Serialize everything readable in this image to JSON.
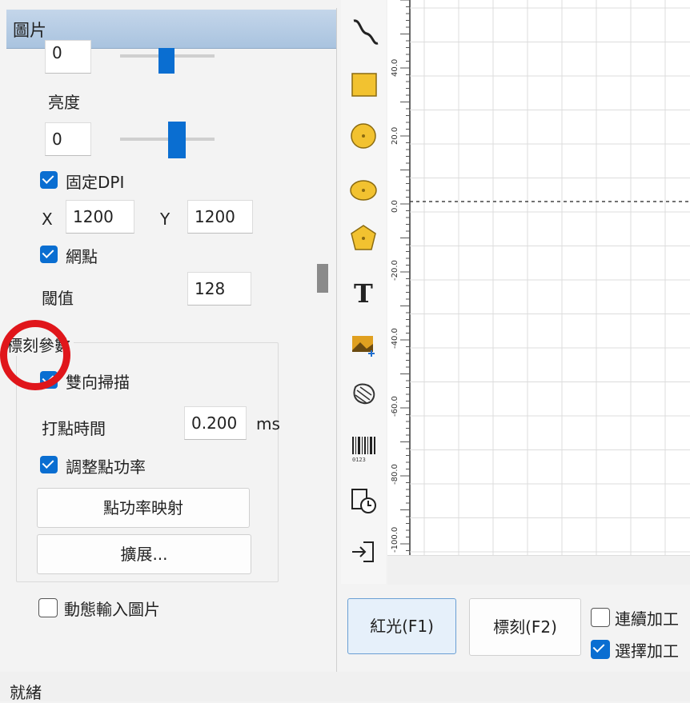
{
  "panel": {
    "title": "圖片",
    "top_field_value": "0",
    "brightness_label": "亮度",
    "brightness_value": "0",
    "fixed_dpi_label": "固定DPI",
    "x_label": "X",
    "x_value": "1200",
    "y_label": "Y",
    "y_value": "1200",
    "halftone_label": "網點",
    "threshold_label": "閾值",
    "threshold_value": "128",
    "marking_group_title": "標刻參數",
    "bidirectional_label": "雙向掃描",
    "dot_time_label": "打點時間",
    "dot_time_value": "0.200",
    "dot_time_unit": "ms",
    "adjust_power_label": "調整點功率",
    "power_map_button": "點功率映射",
    "extend_button": "擴展...",
    "dynamic_input_label": "動態輸入圖片"
  },
  "ruler": {
    "labels": [
      "40.0",
      "20.0",
      "0.0",
      "-20.0",
      "-40.0",
      "-60.0",
      "-80.0",
      "-100.0"
    ]
  },
  "bottom": {
    "red_light_button": "紅光(F1)",
    "mark_button": "標刻(F2)",
    "continuous_label": "連續加工",
    "select_label": "選擇加工"
  },
  "status": {
    "text": "就緒"
  },
  "colors": {
    "accent": "#0a6ed1",
    "annotation_circle": "#e0161b",
    "tool_yellow": "#f2c230"
  },
  "icons": [
    "curve-icon",
    "rectangle-icon",
    "circle-icon",
    "ellipse-icon",
    "polygon-icon",
    "text-icon",
    "image-icon",
    "vector-file-icon",
    "barcode-icon",
    "timer-icon",
    "input-port-icon"
  ]
}
